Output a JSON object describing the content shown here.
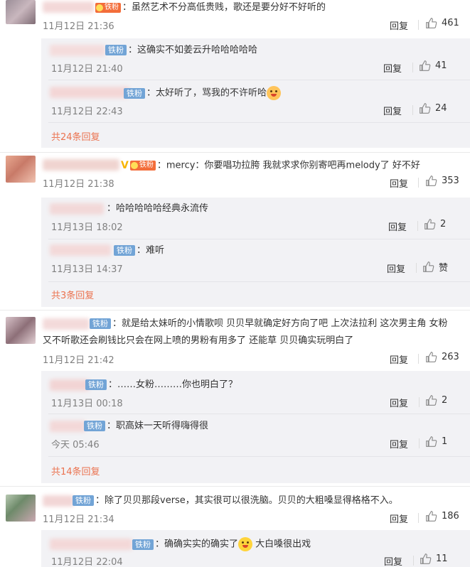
{
  "common": {
    "reply": "回复",
    "iron_fan": "铁粉",
    "iron_fan_orange": "铁粉"
  },
  "c1": {
    "text": "：虽然艺术不分高低贵贱，歌还是要分好不好听的",
    "time": "11月12日 21:36",
    "likes": "461",
    "subs": [
      {
        "text": "：这确实不如姜云升哈哈哈哈哈",
        "time": "11月12日 21:40",
        "likes": "41"
      },
      {
        "text": "：太好听了，骂我的不许听哈",
        "time": "11月12日 22:43",
        "likes": "24"
      }
    ],
    "more": "共24条回复"
  },
  "c2": {
    "text": "：mercy：你要唱功拉胯 我就求求你别寄吧再melody了 好不好",
    "time": "11月12日 21:38",
    "likes": "353",
    "subs": [
      {
        "text": "：哈哈哈哈哈经典永流传",
        "time": "11月13日 18:02",
        "likes": "2"
      },
      {
        "text": "：难听",
        "time": "11月13日 14:37",
        "likes": "赞"
      }
    ],
    "more": "共3条回复"
  },
  "c3": {
    "text_line1": "：就是给太妹听的小情歌呗 贝贝早就确定好方向了吧 上次法拉利 这次男主角 女粉",
    "text_line2": "又不听歌还会刷钱比只会在网上喷的男粉有用多了 还能草 贝贝确实玩明白了",
    "time": "11月12日 21:42",
    "likes": "263",
    "subs": [
      {
        "text": "：……女粉………你也明白了？",
        "time": "11月13日 00:18",
        "likes": "2"
      },
      {
        "text": "：职高妹一天听得嗨得很",
        "time": "今天 05:46",
        "likes": "1"
      }
    ],
    "more": "共14条回复"
  },
  "c4": {
    "text": "：除了贝贝那段verse，其实很可以很洗脑。贝贝的大粗嗓显得格格不入。",
    "time": "11月12日 21:34",
    "likes": "186",
    "subs": [
      {
        "text_a": "：确确实实的确实了",
        "text_b": "大白嗓很出戏",
        "time": "11月12日 22:04",
        "likes": "11"
      }
    ]
  },
  "colors": {
    "accent": "#eb7350",
    "badge_blue": "#72a4d6",
    "badge_orange": "#f36d3a",
    "meta": "#808080",
    "sub_bg": "#f2f2f5"
  },
  "icons": {
    "like": "thumbs-up-icon",
    "vip": "vip-v-icon",
    "emoji": "laughing-face-icon"
  }
}
